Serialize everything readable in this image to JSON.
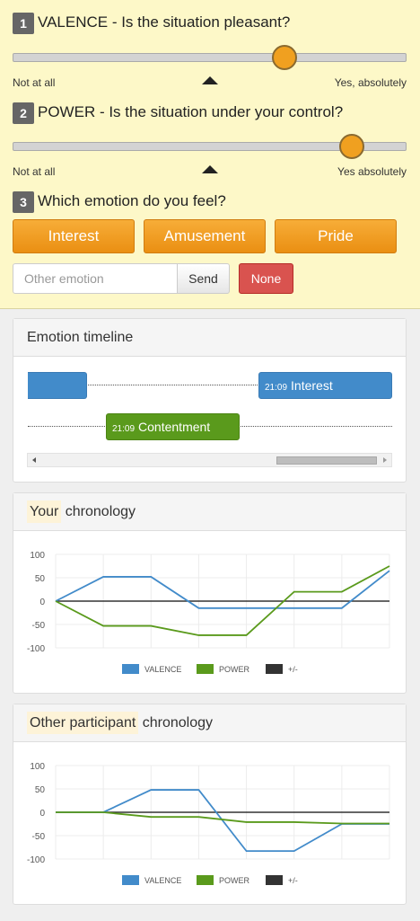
{
  "questions": {
    "valence": {
      "number": "1",
      "text": "VALENCE - Is the situation pleasant?",
      "left_label": "Not at all",
      "right_label": "Yes, absolutely",
      "value": 0.69
    },
    "power": {
      "number": "2",
      "text": "POWER - Is the situation under your control?",
      "left_label": "Not at all",
      "right_label": "Yes absolutely",
      "value": 0.86
    },
    "emotion": {
      "number": "3",
      "text": "Which emotion do you feel?",
      "options": [
        "Interest",
        "Amusement",
        "Pride"
      ],
      "other_placeholder": "Other emotion",
      "send_label": "Send",
      "none_label": "None"
    }
  },
  "timeline": {
    "title": "Emotion timeline",
    "items": [
      {
        "time": "21:09",
        "label": "Interest",
        "color": "#428bca"
      },
      {
        "time": "21:09",
        "label": "Contentment",
        "color": "#5a9a1c"
      }
    ]
  },
  "your_chronology": {
    "title_highlight": "Your",
    "title_rest": " chronology"
  },
  "other_chronology": {
    "title_highlight": "Other participant",
    "title_rest": " chronology"
  },
  "chart_data": [
    {
      "type": "line",
      "title": "Your chronology",
      "ylim": [
        -100,
        100
      ],
      "yticks": [
        100,
        50,
        0,
        -50,
        -100
      ],
      "x": [
        0,
        1,
        2,
        3,
        4,
        5,
        6,
        7
      ],
      "series": [
        {
          "name": "VALENCE",
          "color": "#428bca",
          "values": [
            0,
            52,
            52,
            -15,
            -15,
            -15,
            -15,
            65
          ]
        },
        {
          "name": "POWER",
          "color": "#5a9a1c",
          "values": [
            0,
            -53,
            -53,
            -73,
            -73,
            20,
            20,
            75
          ]
        },
        {
          "name": "+/-",
          "color": "#333333",
          "values": [
            0,
            0,
            0,
            0,
            0,
            0,
            0,
            0
          ]
        }
      ],
      "grid": true,
      "legend": "bottom"
    },
    {
      "type": "line",
      "title": "Other participant chronology",
      "ylim": [
        -100,
        100
      ],
      "yticks": [
        100,
        50,
        0,
        -50,
        -100
      ],
      "x": [
        0,
        1,
        2,
        3,
        4,
        5,
        6,
        7
      ],
      "series": [
        {
          "name": "VALENCE",
          "color": "#428bca",
          "values": [
            0,
            0,
            48,
            48,
            -83,
            -83,
            -25,
            -25
          ]
        },
        {
          "name": "POWER",
          "color": "#5a9a1c",
          "values": [
            0,
            0,
            -10,
            -10,
            -21,
            -21,
            -24,
            -24
          ]
        },
        {
          "name": "+/-",
          "color": "#333333",
          "values": [
            0,
            0,
            0,
            0,
            0,
            0,
            0,
            0
          ]
        }
      ],
      "grid": true,
      "legend": "bottom"
    }
  ]
}
